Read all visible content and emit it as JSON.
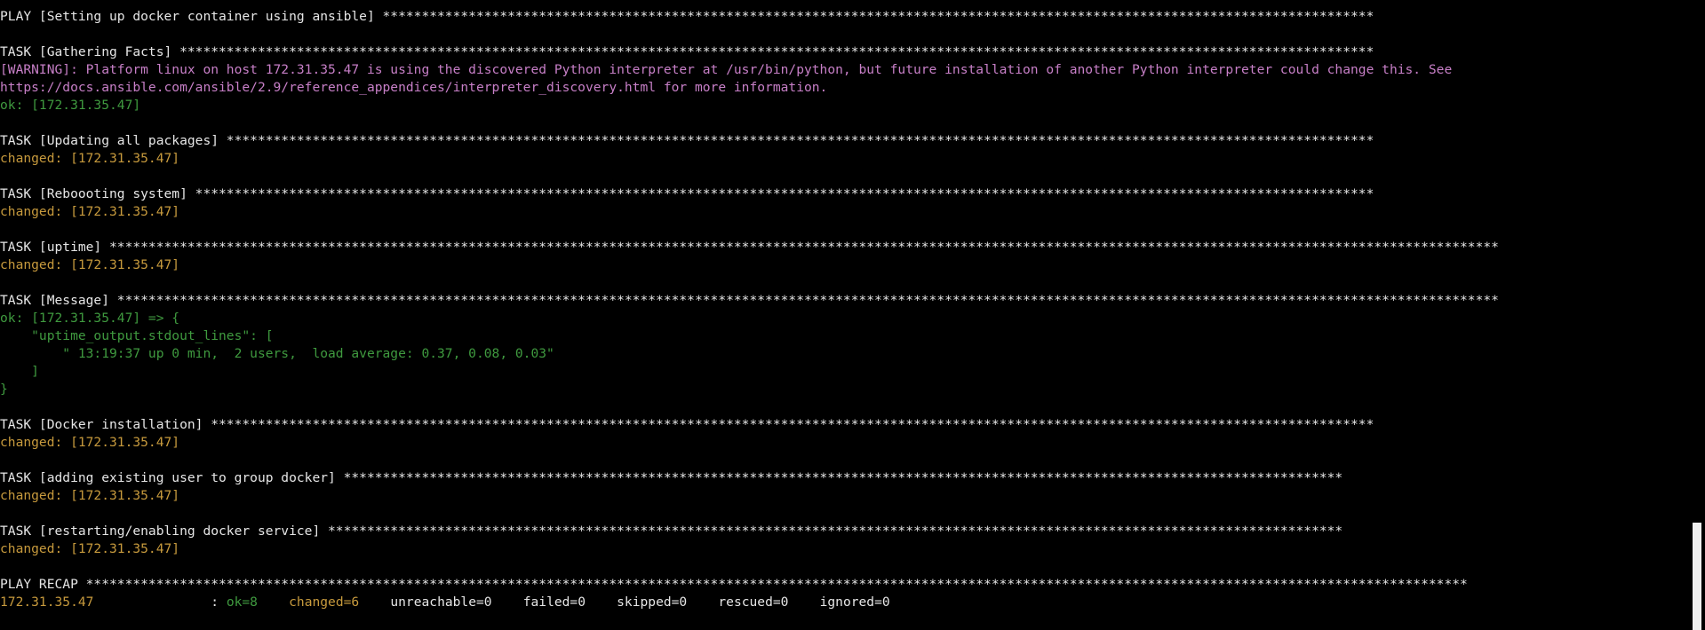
{
  "colors": {
    "background": "#000000",
    "default_text": "#e6e6e6",
    "warning": "#c77fc7",
    "ok": "#3f9a3f",
    "changed": "#c79a3d",
    "scrollbar_thumb": "#f0f0f0"
  },
  "terminal": {
    "lines": [
      {
        "segments": [
          {
            "text": "PLAY [Setting up docker container using ansible] *******************************************************************************************************************************",
            "color": "white"
          }
        ]
      },
      {
        "segments": []
      },
      {
        "segments": [
          {
            "text": "TASK [Gathering Facts] *********************************************************************************************************************************************************",
            "color": "white"
          }
        ]
      },
      {
        "segments": [
          {
            "text": "[WARNING]: Platform linux on host 172.31.35.47 is using the discovered Python interpreter at /usr/bin/python, but future installation of another Python interpreter could change this. See",
            "color": "purple"
          }
        ]
      },
      {
        "segments": [
          {
            "text": "https://docs.ansible.com/ansible/2.9/reference_appendices/interpreter_discovery.html for more information.",
            "color": "purple"
          }
        ]
      },
      {
        "segments": [
          {
            "text": "ok: [172.31.35.47]",
            "color": "green"
          }
        ]
      },
      {
        "segments": []
      },
      {
        "segments": [
          {
            "text": "TASK [Updating all packages] ***************************************************************************************************************************************************",
            "color": "white"
          }
        ]
      },
      {
        "segments": [
          {
            "text": "changed: [172.31.35.47]",
            "color": "yellow"
          }
        ]
      },
      {
        "segments": []
      },
      {
        "segments": [
          {
            "text": "TASK [Reboooting system] *******************************************************************************************************************************************************",
            "color": "white"
          }
        ]
      },
      {
        "segments": [
          {
            "text": "changed: [172.31.35.47]",
            "color": "yellow"
          }
        ]
      },
      {
        "segments": []
      },
      {
        "segments": [
          {
            "text": "TASK [uptime] **********************************************************************************************************************************************************************************",
            "color": "white"
          }
        ]
      },
      {
        "segments": [
          {
            "text": "changed: [172.31.35.47]",
            "color": "yellow"
          }
        ]
      },
      {
        "segments": []
      },
      {
        "segments": [
          {
            "text": "TASK [Message] *********************************************************************************************************************************************************************************",
            "color": "white"
          }
        ]
      },
      {
        "segments": [
          {
            "text": "ok: [172.31.35.47] => {",
            "color": "green"
          }
        ]
      },
      {
        "segments": [
          {
            "text": "    \"uptime_output.stdout_lines\": [",
            "color": "green"
          }
        ]
      },
      {
        "segments": [
          {
            "text": "        \" 13:19:37 up 0 min,  2 users,  load average: 0.37, 0.08, 0.03\"",
            "color": "green"
          }
        ]
      },
      {
        "segments": [
          {
            "text": "    ]",
            "color": "green"
          }
        ]
      },
      {
        "segments": [
          {
            "text": "}",
            "color": "green"
          }
        ]
      },
      {
        "segments": []
      },
      {
        "segments": [
          {
            "text": "TASK [Docker installation] *****************************************************************************************************************************************************",
            "color": "white"
          }
        ]
      },
      {
        "segments": [
          {
            "text": "changed: [172.31.35.47]",
            "color": "yellow"
          }
        ]
      },
      {
        "segments": []
      },
      {
        "segments": [
          {
            "text": "TASK [adding existing user to group docker] ********************************************************************************************************************************",
            "color": "white"
          }
        ]
      },
      {
        "segments": [
          {
            "text": "changed: [172.31.35.47]",
            "color": "yellow"
          }
        ]
      },
      {
        "segments": []
      },
      {
        "segments": [
          {
            "text": "TASK [restarting/enabling docker service] **********************************************************************************************************************************",
            "color": "white"
          }
        ]
      },
      {
        "segments": [
          {
            "text": "changed: [172.31.35.47]",
            "color": "yellow"
          }
        ]
      },
      {
        "segments": []
      },
      {
        "segments": [
          {
            "text": "PLAY RECAP *********************************************************************************************************************************************************************************",
            "color": "white"
          }
        ]
      },
      {
        "segments": [
          {
            "text": "172.31.35.47",
            "color": "yellow"
          },
          {
            "text": "               : ",
            "color": "white"
          },
          {
            "text": "ok=8",
            "color": "green"
          },
          {
            "text": "    ",
            "color": "white"
          },
          {
            "text": "changed=6",
            "color": "yellow"
          },
          {
            "text": "    unreachable=0    failed=0    skipped=0    rescued=0    ignored=0",
            "color": "white"
          }
        ]
      }
    ]
  }
}
